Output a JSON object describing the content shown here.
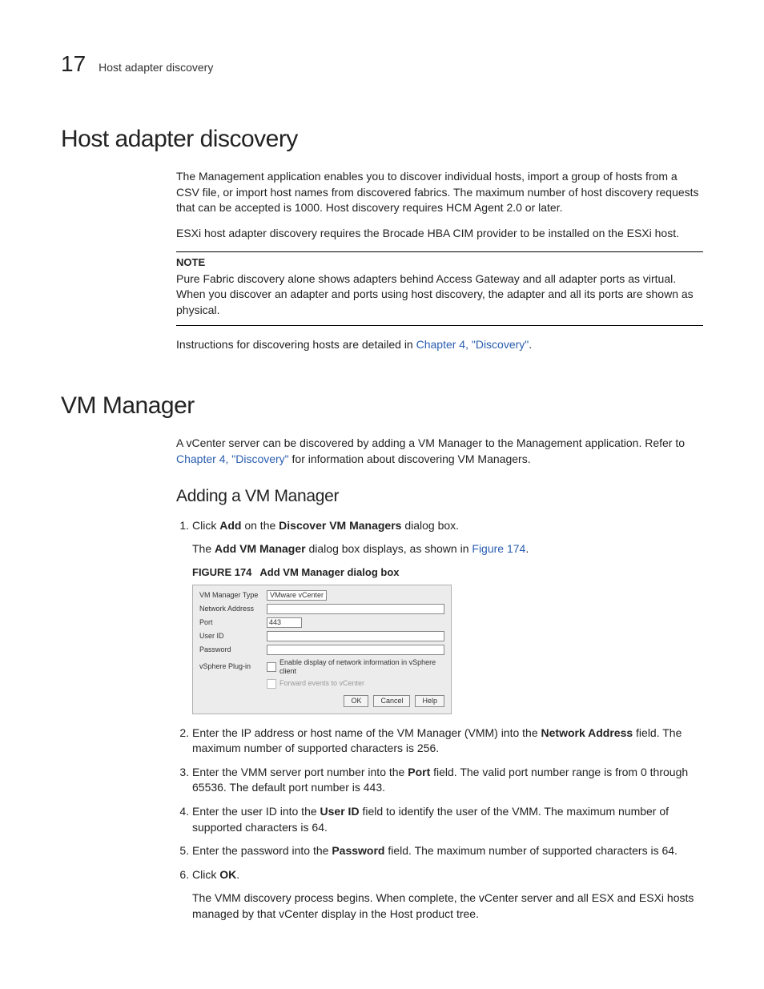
{
  "header": {
    "chapter": "17",
    "crumb": "Host adapter discovery"
  },
  "host_adapter": {
    "title": "Host adapter discovery",
    "p1": "The Management application enables you to discover individual hosts, import a group of hosts from a CSV file, or import host names from discovered fabrics. The maximum number of host discovery requests that can be accepted is 1000. Host discovery requires HCM Agent 2.0 or later.",
    "p2": "ESXi host adapter discovery requires the Brocade HBA CIM provider to be installed on the ESXi host.",
    "note_label": "NOTE",
    "note_body": "Pure Fabric discovery alone shows adapters behind Access Gateway and all adapter ports as virtual. When you discover an adapter and ports using host discovery, the adapter and all its ports are shown as physical.",
    "p3_pre": "Instructions for discovering hosts are detailed in ",
    "p3_link": "Chapter 4, \"Discovery\"",
    "p3_post": "."
  },
  "vm_manager": {
    "title": "VM Manager",
    "intro_pre": "A vCenter server can be discovered by adding a VM Manager to the Management application. Refer to ",
    "intro_link": "Chapter 4, \"Discovery\"",
    "intro_post": " for information about discovering VM Managers.",
    "sub_title": "Adding a VM Manager",
    "steps": {
      "s1": {
        "pre": "Click ",
        "b1": "Add",
        "mid": " on the ",
        "b2": "Discover VM Managers",
        "post": " dialog box."
      },
      "s1_extra": {
        "pre": "The ",
        "b": "Add VM Manager",
        "mid": " dialog box displays, as shown in ",
        "link": "Figure 174",
        "post": "."
      },
      "fig": {
        "num": "FIGURE 174",
        "caption": "Add VM Manager dialog box"
      },
      "s2": {
        "pre": "Enter the IP address or host name of the VM Manager (VMM) into the ",
        "b": "Network Address",
        "post": " field. The maximum number of supported characters is 256."
      },
      "s3": {
        "pre": "Enter the VMM server port number into the ",
        "b": "Port",
        "post": " field. The valid port number range is from 0 through 65536. The default port number is 443."
      },
      "s4": {
        "pre": "Enter the user ID into the ",
        "b": "User ID",
        "post": " field to identify the user of the VMM. The maximum number of supported characters is 64."
      },
      "s5": {
        "pre": "Enter the password into the ",
        "b": "Password",
        "post": " field. The maximum number of supported characters is 64."
      },
      "s6": {
        "pre": "Click ",
        "b": "OK",
        "post": "."
      },
      "s6_extra": "The VMM discovery process begins. When complete, the vCenter server and all ESX and ESXi hosts managed by that vCenter display in the Host product tree."
    }
  },
  "dialog": {
    "labels": {
      "vm_type": "VM Manager Type",
      "net_addr": "Network Address",
      "port": "Port",
      "user_id": "User ID",
      "password": "Password",
      "plugin": "vSphere Plug-in"
    },
    "values": {
      "vm_type": "VMware vCenter",
      "port": "443"
    },
    "check1": "Enable display of network information in vSphere client",
    "check2": "Forward events to vCenter",
    "buttons": {
      "ok": "OK",
      "cancel": "Cancel",
      "help": "Help"
    }
  }
}
